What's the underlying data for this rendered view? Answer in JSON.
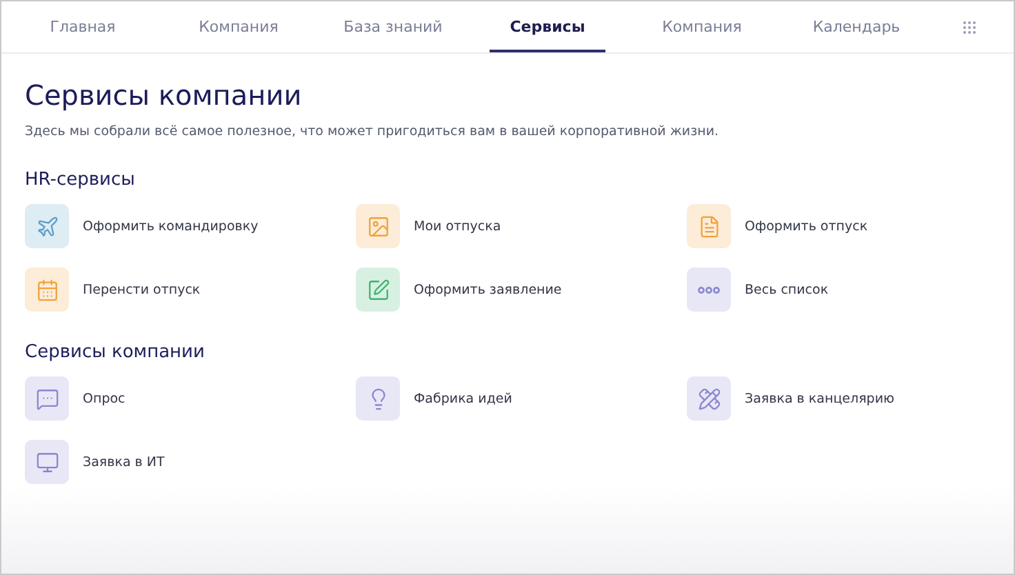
{
  "tabs": [
    {
      "label": "Главная",
      "selected": false
    },
    {
      "label": "Компания",
      "selected": false
    },
    {
      "label": "База знаний",
      "selected": false
    },
    {
      "label": "Сервисы",
      "selected": true
    },
    {
      "label": "Компания",
      "selected": false
    },
    {
      "label": "Календарь",
      "selected": false
    }
  ],
  "page": {
    "title": "Сервисы компании",
    "subtitle": "Здесь мы собрали всё самое полезное, что может пригодиться вам в вашей корпоративной жизни."
  },
  "sections": [
    {
      "title": "HR-сервисы",
      "items": [
        {
          "label": "Оформить командировку",
          "color": "#5b9fc9"
        },
        {
          "label": "Мои отпуска",
          "color": "#f0a23a"
        },
        {
          "label": "Оформить отпуск",
          "color": "#f0a23a"
        },
        {
          "label": "Перенсти отпуск",
          "color": "#f0a23a"
        },
        {
          "label": "Оформить заявление",
          "color": "#3cb46e"
        },
        {
          "label": "Весь список",
          "color": "#8a86d0"
        }
      ]
    },
    {
      "title": "Сервисы компании",
      "items": [
        {
          "label": "Опрос",
          "color": "#8a86d0"
        },
        {
          "label": "Фабрика идей",
          "color": "#8a86d0"
        },
        {
          "label": "Заявка в канцелярию",
          "color": "#8a86d0"
        },
        {
          "label": "Заявка в ИТ",
          "color": "#8a86d0"
        }
      ]
    }
  ]
}
